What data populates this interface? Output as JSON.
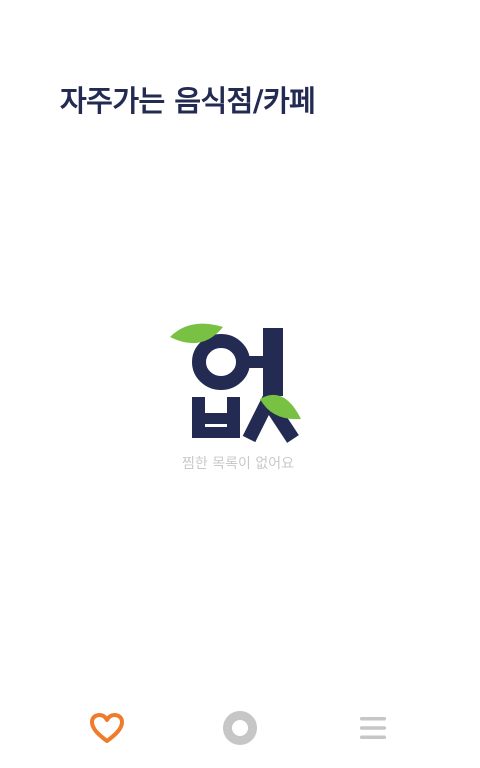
{
  "header": {
    "title": "자주가는 음식점/카페"
  },
  "empty_state": {
    "logo_text": "없",
    "message": "찜한 목록이 없어요"
  },
  "colors": {
    "title": "#232b52",
    "logo_navy": "#232b52",
    "logo_leaf": "#78c142",
    "message": "#c9c9c9",
    "nav_active": "#f07b2b",
    "nav_inactive": "#c6c6c6"
  },
  "nav": {
    "items": [
      {
        "icon": "heart-icon",
        "active": true
      },
      {
        "icon": "circle-icon",
        "active": false
      },
      {
        "icon": "menu-icon",
        "active": false
      }
    ]
  }
}
